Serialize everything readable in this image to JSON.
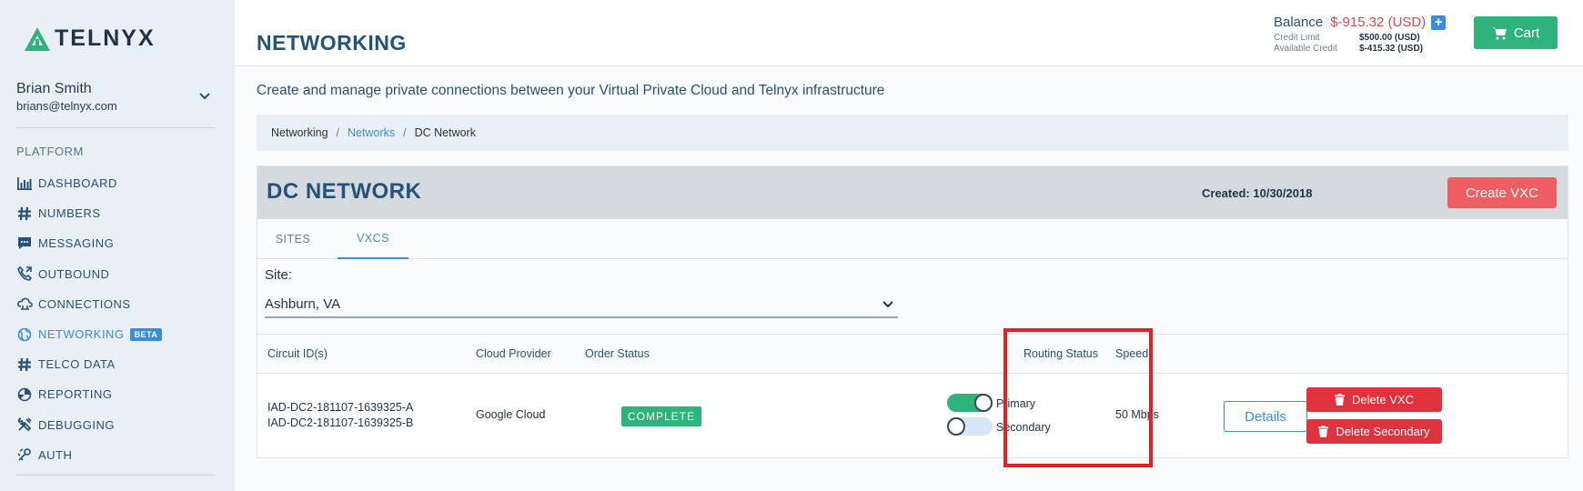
{
  "brand": {
    "name": "TELNYX"
  },
  "user": {
    "name": "Brian Smith",
    "email": "brians@telnyx.com"
  },
  "sidebar": {
    "section_label": "PLATFORM",
    "items": [
      {
        "label": "DASHBOARD",
        "icon": "bar-chart-icon"
      },
      {
        "label": "NUMBERS",
        "icon": "hash-icon"
      },
      {
        "label": "MESSAGING",
        "icon": "chat-icon"
      },
      {
        "label": "OUTBOUND",
        "icon": "phone-outbound-icon"
      },
      {
        "label": "CONNECTIONS",
        "icon": "cloud-connection-icon"
      },
      {
        "label": "NETWORKING",
        "icon": "globe-icon",
        "badge": "BETA",
        "active": true
      },
      {
        "label": "TELCO DATA",
        "icon": "hash-icon"
      },
      {
        "label": "REPORTING",
        "icon": "pie-chart-icon"
      },
      {
        "label": "DEBUGGING",
        "icon": "tools-icon"
      },
      {
        "label": "AUTH",
        "icon": "key-icon"
      }
    ]
  },
  "header": {
    "title": "NETWORKING",
    "balance": {
      "label": "Balance",
      "value": "$-915.32 (USD)",
      "credit_limit_label": "Credit Limit",
      "credit_limit_value": "$500.00 (USD)",
      "available_credit_label": "Available Credit",
      "available_credit_value": "$-415.32 (USD)"
    },
    "cart_label": "Cart"
  },
  "subtitle": "Create and manage private connections between your Virtual Private Cloud and Telnyx infrastructure",
  "breadcrumb": [
    "Networking",
    "Networks",
    "DC Network"
  ],
  "network": {
    "title": "DC NETWORK",
    "created_label": "Created:",
    "created_value": "10/30/2018",
    "create_button": "Create VXC",
    "tabs": [
      {
        "label": "SITES",
        "active": false
      },
      {
        "label": "VXCS",
        "active": true
      }
    ],
    "site_label": "Site:",
    "site_value": "Ashburn, VA",
    "table": {
      "headers": [
        "Circuit ID(s)",
        "Cloud Provider",
        "Order Status",
        "Routing Status",
        "Speed"
      ],
      "rows": [
        {
          "circuit_a": "IAD-DC2-181107-1639325-A",
          "circuit_b": "IAD-DC2-181107-1639325-B",
          "provider": "Google Cloud",
          "order_status": "COMPLETE",
          "routing_primary_label": "Primary",
          "routing_primary_on": true,
          "routing_secondary_label": "Secondary",
          "routing_secondary_on": false,
          "speed": "50 Mbps",
          "details_button": "Details",
          "delete_vxc_button": "Delete VXC",
          "delete_secondary_button": "Delete Secondary"
        }
      ]
    }
  },
  "colors": {
    "accent": "#3a8dde",
    "success": "#2fb27b",
    "danger": "#e0333e",
    "highlight": "#e8201f"
  }
}
